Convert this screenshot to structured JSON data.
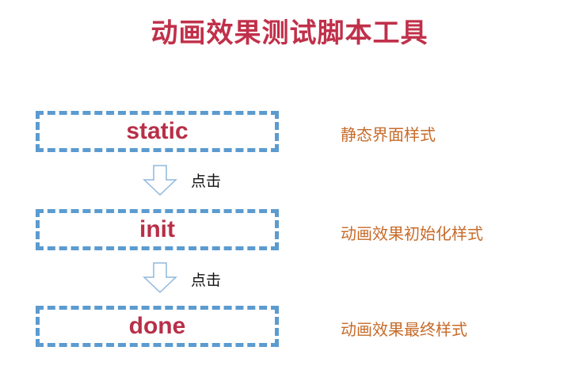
{
  "title": "动画效果测试脚本工具",
  "stages": [
    {
      "label": "static",
      "description": "静态界面样式"
    },
    {
      "label": "init",
      "description": "动画效果初始化样式"
    },
    {
      "label": "done",
      "description": "动画效果最终样式"
    }
  ],
  "transitions": [
    {
      "label": "点击"
    },
    {
      "label": "点击"
    }
  ],
  "colors": {
    "title": "#c0304a",
    "stage_label": "#b82f48",
    "box_border": "#5b9bd0",
    "description": "#c76b2a",
    "arrow": "#8fb8dc"
  }
}
